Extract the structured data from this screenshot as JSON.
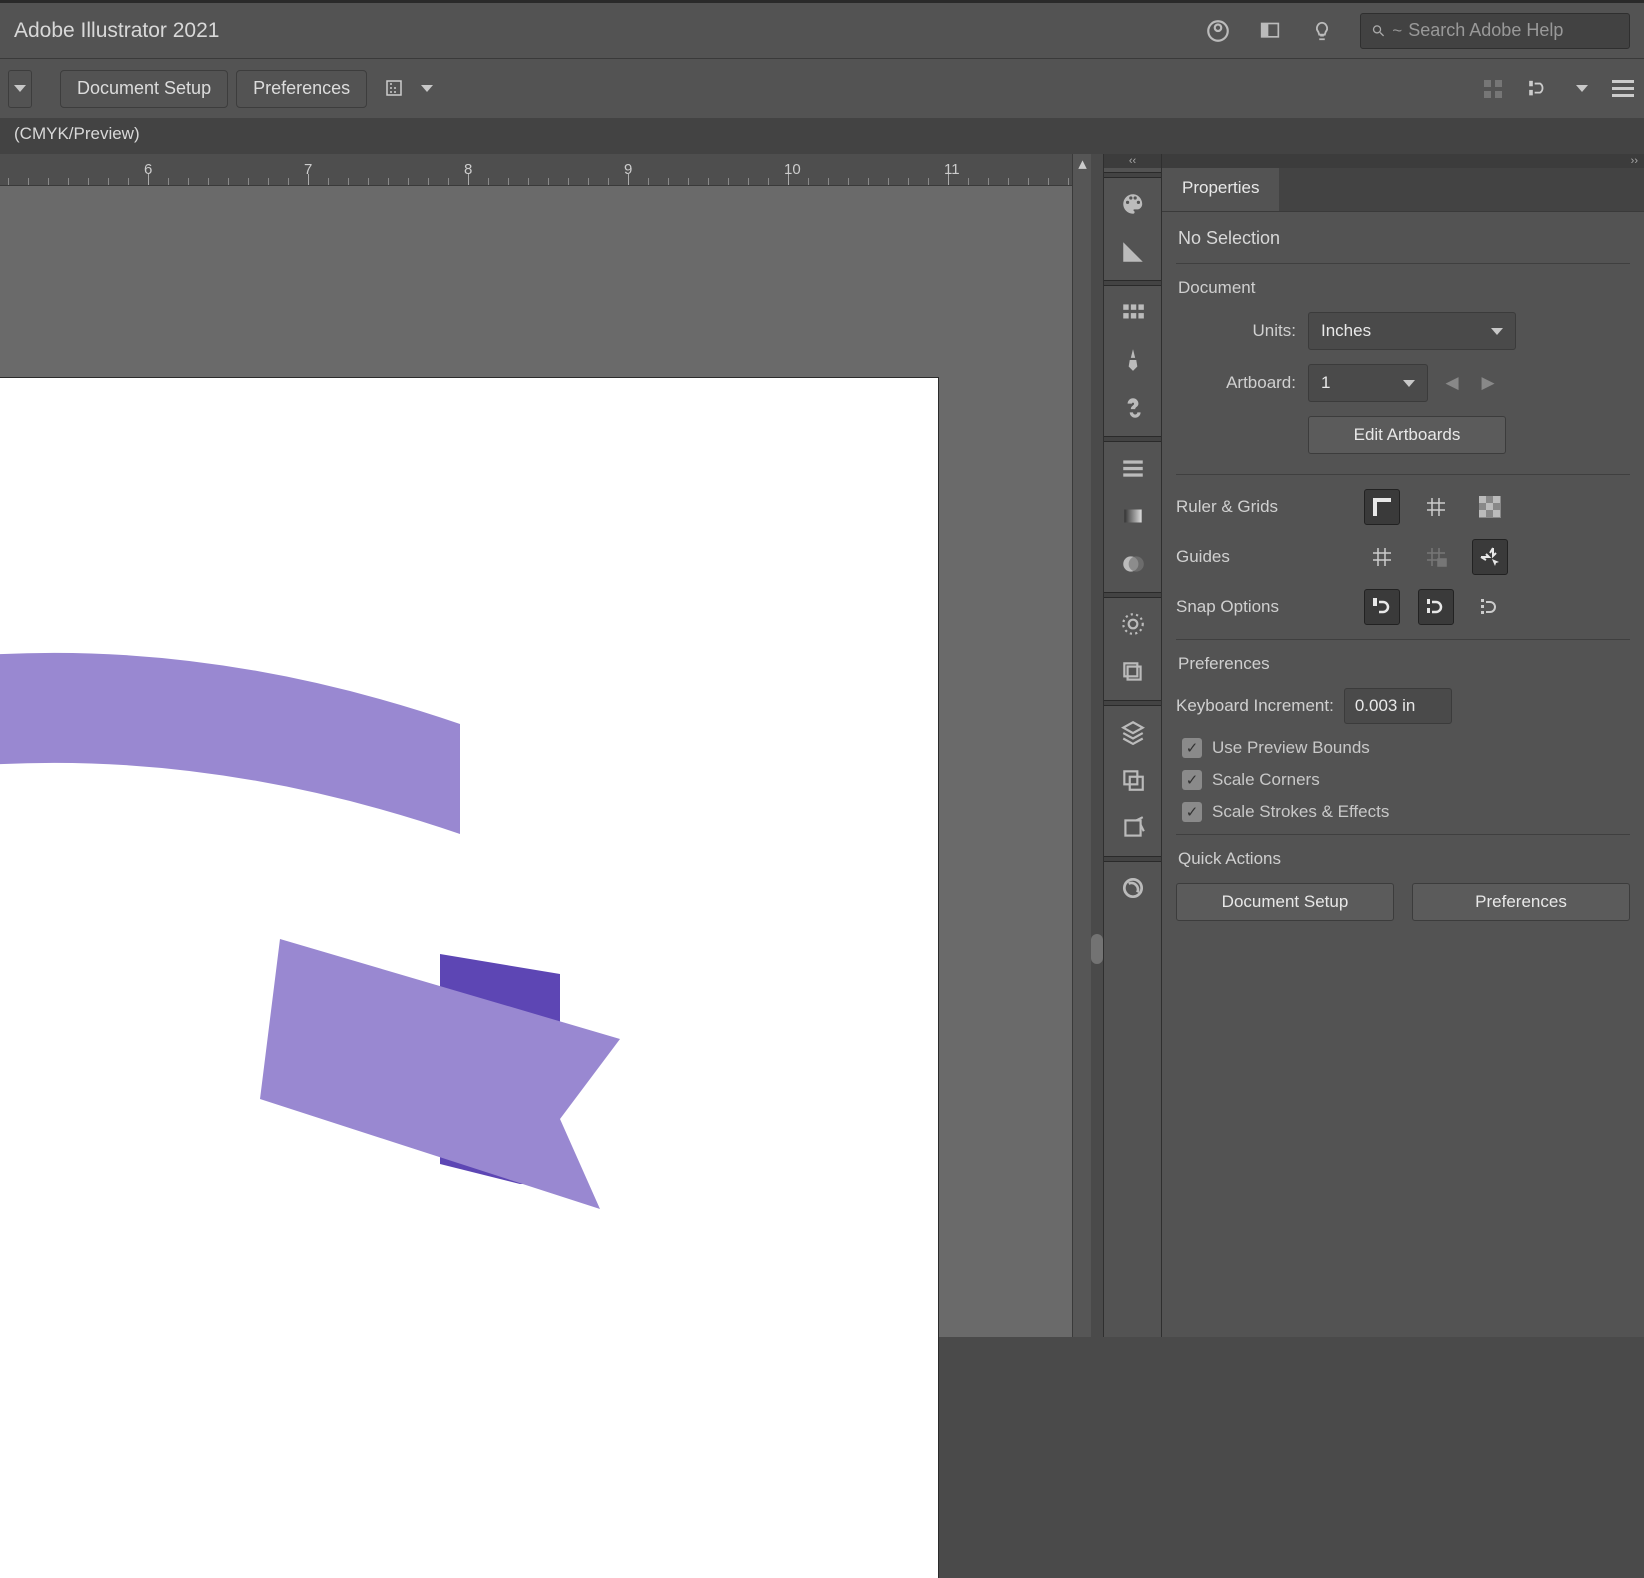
{
  "title": "Adobe Illustrator 2021",
  "search_placeholder": "Search Adobe Help",
  "options_bar": {
    "doc_setup": "Document Setup",
    "preferences": "Preferences"
  },
  "tab": "(CMYK/Preview)",
  "ruler": {
    "labels": [
      "6",
      "7",
      "8",
      "9",
      "10",
      "11"
    ]
  },
  "dock_icons": [
    "color-palette-icon",
    "color-guide-icon",
    "swatches-icon",
    "brushes-icon",
    "symbols-icon",
    "stroke-icon",
    "gradient-icon",
    "transparency-icon",
    "appearance-icon",
    "graphic-styles-icon",
    "layers-icon",
    "asset-export-icon",
    "artboards-icon",
    "libraries-icon"
  ],
  "props": {
    "tab": "Properties",
    "selection": "No Selection",
    "document": {
      "title": "Document",
      "units_label": "Units:",
      "units_value": "Inches",
      "artboard_label": "Artboard:",
      "artboard_value": "1",
      "edit_artboards": "Edit Artboards"
    },
    "ruler_grids": "Ruler & Grids",
    "guides": "Guides",
    "snap_options": "Snap Options",
    "prefs": {
      "title": "Preferences",
      "kb_increment_label": "Keyboard Increment:",
      "kb_increment_value": "0.003 in",
      "use_preview_bounds": "Use Preview Bounds",
      "scale_corners": "Scale Corners",
      "scale_strokes": "Scale Strokes & Effects"
    },
    "quick_actions": {
      "title": "Quick Actions",
      "doc_setup": "Document Setup",
      "preferences": "Preferences"
    }
  }
}
